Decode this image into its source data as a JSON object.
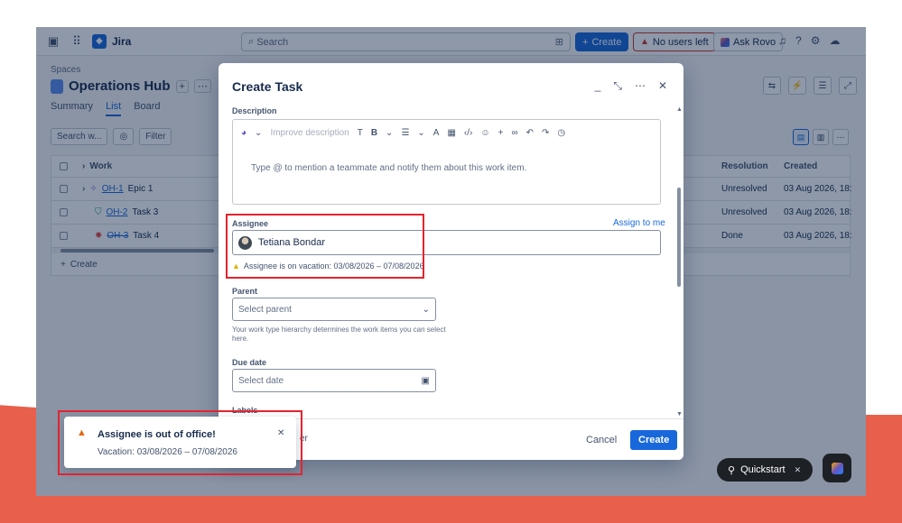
{
  "nav": {
    "product": "Jira",
    "search_placeholder": "Search",
    "create_label": "Create",
    "no_users_label": "No users left",
    "rovo_label": "Ask Rovo"
  },
  "space": {
    "spaces_label": "Spaces",
    "title": "Operations Hub",
    "tabs": [
      "Summary",
      "List",
      "Board"
    ]
  },
  "filters": {
    "search_placeholder": "Search w...",
    "filter_label": "Filter"
  },
  "table": {
    "headers": {
      "work": "Work",
      "resolution": "Resolution",
      "created": "Created"
    },
    "rows": [
      {
        "key": "OH-1",
        "title": "Epic 1",
        "resolution": "Unresolved",
        "created": "03 Aug 2026, 18:5"
      },
      {
        "key": "OH-2",
        "title": "Task 3",
        "resolution": "Unresolved",
        "created": "03 Aug 2026, 18:5"
      },
      {
        "key": "OH-3",
        "title": "Task 4",
        "resolution": "Done",
        "created": "03 Aug 2026, 18:5"
      }
    ],
    "add_label": "Create"
  },
  "modal": {
    "title": "Create Task",
    "description_label": "Description",
    "improve_label": "Improve description",
    "description_placeholder": "Type @ to mention a teammate and notify them about this work item.",
    "assignee_label": "Assignee",
    "assign_to_me": "Assign to me",
    "assignee_name": "Tetiana Bondar",
    "vacation_warning": "Assignee is on vacation: 03/08/2026 – 07/08/2026",
    "parent_label": "Parent",
    "parent_placeholder": "Select parent",
    "parent_helper": "Your work type hierarchy determines the work items you can select here.",
    "due_label": "Due date",
    "due_placeholder": "Select date",
    "labels_label": "Labels",
    "cancel_label": "Cancel",
    "create_label": "Create",
    "footer_stub": "er"
  },
  "toast": {
    "title": "Assignee is out of office!",
    "message": "Vacation: 03/08/2026 – 07/08/2026"
  },
  "quickstart": {
    "label": "Quickstart"
  },
  "colors": {
    "accent": "#1868db",
    "danger": "#c9372c",
    "highlight_box": "#e2242f",
    "background_band": "#e8604c"
  }
}
